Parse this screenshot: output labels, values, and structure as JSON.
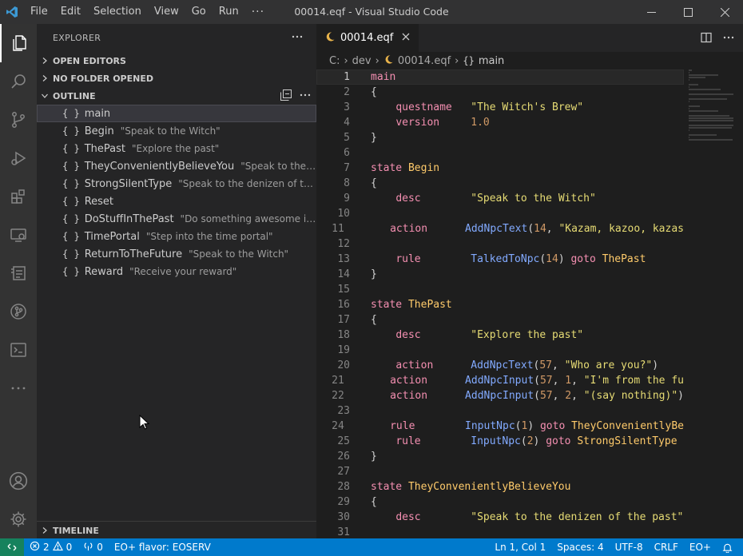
{
  "titlebar": {
    "menu": [
      "File",
      "Edit",
      "Selection",
      "View",
      "Go",
      "Run"
    ],
    "more": "···",
    "title": "00014.eqf - Visual Studio Code"
  },
  "activitybar": {
    "icons": [
      "files-icon",
      "search-icon",
      "source-control-icon",
      "run-debug-icon",
      "extensions-icon",
      "remote-explorer-icon",
      "testing-icon",
      "git-graph-icon",
      "terminal-icon",
      "more-icon",
      "account-icon",
      "settings-gear-icon"
    ]
  },
  "sidebar": {
    "header": "EXPLORER",
    "open_editors": "OPEN EDITORS",
    "no_folder": "NO FOLDER OPENED",
    "outline": "OUTLINE",
    "timeline": "TIMELINE",
    "outline_items": [
      {
        "name": "main",
        "desc": ""
      },
      {
        "name": "Begin",
        "desc": "\"Speak to the Witch\""
      },
      {
        "name": "ThePast",
        "desc": "\"Explore the past\""
      },
      {
        "name": "TheyConvenientlyBelieveYou",
        "desc": "\"Speak to the denizen ..."
      },
      {
        "name": "StrongSilentType",
        "desc": "\"Speak to the denizen of the past\""
      },
      {
        "name": "Reset",
        "desc": ""
      },
      {
        "name": "DoStuffInThePast",
        "desc": "\"Do something awesome in the past\""
      },
      {
        "name": "TimePortal",
        "desc": "\"Step into the time portal\""
      },
      {
        "name": "ReturnToTheFuture",
        "desc": "\"Speak to the Witch\""
      },
      {
        "name": "Reward",
        "desc": "\"Receive your reward\""
      }
    ]
  },
  "editor": {
    "tab_label": "00014.eqf",
    "breadcrumbs": [
      "C:",
      "dev",
      "00014.eqf",
      "main"
    ],
    "current_line": 1,
    "lines": [
      [
        [
          "kw",
          "main"
        ]
      ],
      [
        [
          "pr",
          "{"
        ]
      ],
      [
        [
          "pr",
          "    "
        ],
        [
          "kw",
          "questname"
        ],
        [
          "pr",
          "   "
        ],
        [
          "strg",
          "\"The Witch's Brew\""
        ]
      ],
      [
        [
          "pr",
          "    "
        ],
        [
          "kw",
          "version"
        ],
        [
          "pr",
          "     "
        ],
        [
          "nm",
          "1.0"
        ]
      ],
      [
        [
          "pr",
          "}"
        ]
      ],
      [],
      [
        [
          "kw",
          "state "
        ],
        [
          "st",
          "Begin"
        ]
      ],
      [
        [
          "pr",
          "{"
        ]
      ],
      [
        [
          "pr",
          "    "
        ],
        [
          "kw",
          "desc"
        ],
        [
          "pr",
          "        "
        ],
        [
          "strg",
          "\"Speak to the Witch\""
        ]
      ],
      [],
      [
        [
          "pr",
          "    "
        ],
        [
          "kw",
          "action"
        ],
        [
          "pr",
          "      "
        ],
        [
          "fn",
          "AddNpcText"
        ],
        [
          "pr",
          "("
        ],
        [
          "nm",
          "14"
        ],
        [
          "pr",
          ", "
        ],
        [
          "strg",
          "\"Kazam, kazoo, kazas"
        ]
      ],
      [],
      [
        [
          "pr",
          "    "
        ],
        [
          "kw",
          "rule"
        ],
        [
          "pr",
          "        "
        ],
        [
          "fn",
          "TalkedToNpc"
        ],
        [
          "pr",
          "("
        ],
        [
          "nm",
          "14"
        ],
        [
          "pr",
          ") "
        ],
        [
          "kw",
          "goto "
        ],
        [
          "st",
          "ThePast"
        ]
      ],
      [
        [
          "pr",
          "}"
        ]
      ],
      [],
      [
        [
          "kw",
          "state "
        ],
        [
          "st",
          "ThePast"
        ]
      ],
      [
        [
          "pr",
          "{"
        ]
      ],
      [
        [
          "pr",
          "    "
        ],
        [
          "kw",
          "desc"
        ],
        [
          "pr",
          "        "
        ],
        [
          "strg",
          "\"Explore the past\""
        ]
      ],
      [],
      [
        [
          "pr",
          "    "
        ],
        [
          "kw",
          "action"
        ],
        [
          "pr",
          "      "
        ],
        [
          "fn",
          "AddNpcText"
        ],
        [
          "pr",
          "("
        ],
        [
          "nm",
          "57"
        ],
        [
          "pr",
          ", "
        ],
        [
          "strg",
          "\"Who are you?\""
        ],
        [
          "pr",
          ")"
        ]
      ],
      [
        [
          "pr",
          "    "
        ],
        [
          "kw",
          "action"
        ],
        [
          "pr",
          "      "
        ],
        [
          "fn",
          "AddNpcInput"
        ],
        [
          "pr",
          "("
        ],
        [
          "nm",
          "57"
        ],
        [
          "pr",
          ", "
        ],
        [
          "nm",
          "1"
        ],
        [
          "pr",
          ", "
        ],
        [
          "strg",
          "\"I'm from the fu"
        ]
      ],
      [
        [
          "pr",
          "    "
        ],
        [
          "kw",
          "action"
        ],
        [
          "pr",
          "      "
        ],
        [
          "fn",
          "AddNpcInput"
        ],
        [
          "pr",
          "("
        ],
        [
          "nm",
          "57"
        ],
        [
          "pr",
          ", "
        ],
        [
          "nm",
          "2"
        ],
        [
          "pr",
          ", "
        ],
        [
          "strg",
          "\"(say nothing)\""
        ],
        [
          "pr",
          ")"
        ]
      ],
      [],
      [
        [
          "pr",
          "    "
        ],
        [
          "kw",
          "rule"
        ],
        [
          "pr",
          "        "
        ],
        [
          "fn",
          "InputNpc"
        ],
        [
          "pr",
          "("
        ],
        [
          "nm",
          "1"
        ],
        [
          "pr",
          ") "
        ],
        [
          "kw",
          "goto "
        ],
        [
          "st",
          "TheyConvenientlyBe"
        ]
      ],
      [
        [
          "pr",
          "    "
        ],
        [
          "kw",
          "rule"
        ],
        [
          "pr",
          "        "
        ],
        [
          "fn",
          "InputNpc"
        ],
        [
          "pr",
          "("
        ],
        [
          "nm",
          "2"
        ],
        [
          "pr",
          ") "
        ],
        [
          "kw",
          "goto "
        ],
        [
          "st",
          "StrongSilentType"
        ]
      ],
      [
        [
          "pr",
          "}"
        ]
      ],
      [],
      [
        [
          "kw",
          "state "
        ],
        [
          "st",
          "TheyConvenientlyBelieveYou"
        ]
      ],
      [
        [
          "pr",
          "{"
        ]
      ],
      [
        [
          "pr",
          "    "
        ],
        [
          "kw",
          "desc"
        ],
        [
          "pr",
          "        "
        ],
        [
          "strg",
          "\"Speak to the denizen of the past\""
        ]
      ],
      []
    ]
  },
  "statusbar": {
    "errors": "2",
    "warnings": "0",
    "info": "0",
    "flavor": "EO+ flavor: EOSERV",
    "position": "Ln 1, Col 1",
    "spaces": "Spaces: 4",
    "encoding": "UTF-8",
    "eol": "CRLF",
    "language": "EO+"
  }
}
